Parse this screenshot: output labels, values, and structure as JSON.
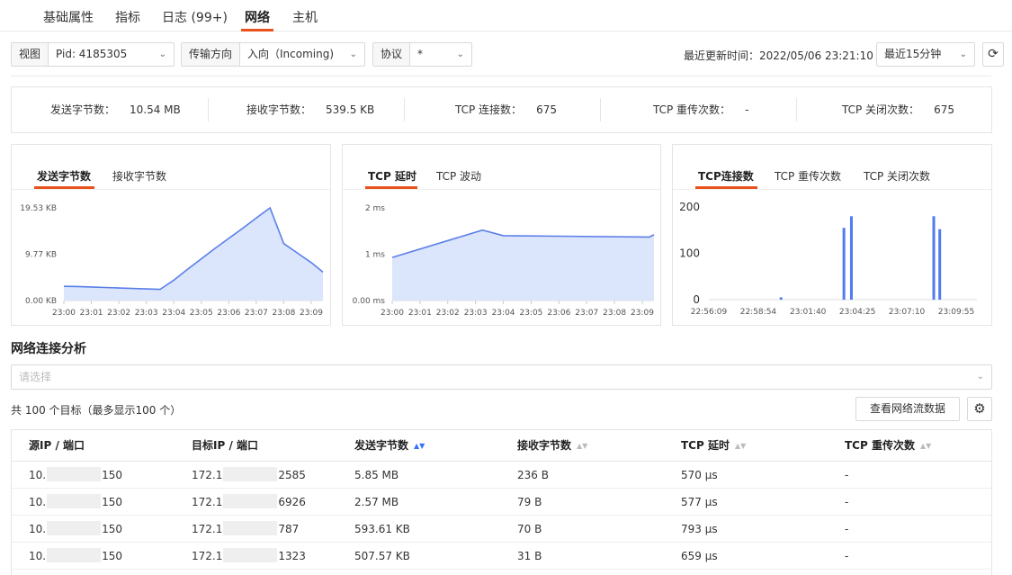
{
  "tabs": [
    {
      "label": "基础属性"
    },
    {
      "label": "指标"
    },
    {
      "label": "日志 (99+)"
    },
    {
      "label": "网络",
      "active": true
    },
    {
      "label": "主机"
    }
  ],
  "filters": {
    "view_label": "视图",
    "view_value": "Pid: 4185305",
    "direction_label": "传输方向",
    "direction_value": "入向（Incoming)",
    "protocol_label": "协议",
    "protocol_value": "*",
    "updated_label": "最近更新时间：2022/05/06 23:21:10",
    "range_value": "最近15分钟"
  },
  "stats": [
    {
      "label": "发送字节数：",
      "value": "10.54 MB"
    },
    {
      "label": "接收字节数：",
      "value": "539.5 KB"
    },
    {
      "label": "TCP 连接数：",
      "value": "675"
    },
    {
      "label": "TCP 重传次数：",
      "value": "-"
    },
    {
      "label": "TCP 关闭次数：",
      "value": "675"
    }
  ],
  "panels": [
    {
      "tabs": [
        "发送字节数",
        "接收字节数"
      ],
      "active": 0
    },
    {
      "tabs": [
        "TCP 延时",
        "TCP 波动"
      ],
      "active": 0
    },
    {
      "tabs": [
        "TCP连接数",
        "TCP 重传次数",
        "TCP 关闭次数"
      ],
      "active": 0
    }
  ],
  "chart_data": [
    {
      "type": "area",
      "title": "发送字节数",
      "yticks": [
        "19.53 KB",
        "9.77 KB",
        "0.00 KB"
      ],
      "ylim": [
        0,
        19.53
      ],
      "x": [
        "23:00",
        "23:00:30",
        "23:01",
        "23:01:30",
        "23:02",
        "23:02:30",
        "23:03",
        "23:03:30",
        "23:04",
        "23:04:30",
        "23:05",
        "23:05:30",
        "23:06",
        "23:06:30",
        "23:07",
        "23:07:30",
        "23:08",
        "23:08:30",
        "23:09",
        "23:09:30"
      ],
      "xticks": [
        "23:00",
        "23:01",
        "23:02",
        "23:03",
        "23:04",
        "23:05",
        "23:06",
        "23:07",
        "23:08",
        "23:09"
      ],
      "values": [
        3.0,
        2.95,
        2.85,
        2.75,
        2.65,
        2.55,
        2.45,
        2.35,
        4.3,
        6.6,
        8.8,
        11.0,
        13.1,
        15.2,
        17.4,
        19.53,
        12.0,
        10.0,
        8.0,
        6.0
      ],
      "series_color": "#5b7fe8"
    },
    {
      "type": "area",
      "title": "TCP 延时",
      "yticks": [
        "2 ms",
        "1 ms",
        "0.00 ms"
      ],
      "ylim": [
        0,
        2
      ],
      "x": [
        "23:00",
        "23:03:15",
        "23:04",
        "23:09:15",
        "23:09:45"
      ],
      "xticks": [
        "23:00",
        "23:01",
        "23:02",
        "23:03",
        "23:04",
        "23:05",
        "23:06",
        "23:07",
        "23:08",
        "23:09"
      ],
      "values": [
        0.93,
        1.52,
        1.4,
        1.37,
        1.42
      ],
      "series_color": "#5b7fe8"
    },
    {
      "type": "bar",
      "title": "TCP连接数",
      "yticks": [
        "200",
        "100",
        "0"
      ],
      "ylim": [
        0,
        200
      ],
      "xticks": [
        "22:56:09",
        "22:58:54",
        "23:01:40",
        "23:04:25",
        "23:07:10",
        "23:09:55"
      ],
      "bars": [
        {
          "t": "23:00:10",
          "value": 5
        },
        {
          "t": "23:03:40",
          "value": 155
        },
        {
          "t": "23:04:05",
          "value": 180
        },
        {
          "t": "23:08:40",
          "value": 180
        },
        {
          "t": "23:09:00",
          "value": 152
        }
      ],
      "series_color": "#4f7cf0"
    }
  ],
  "section": {
    "title": "网络连接分析",
    "select_placeholder": "请选择",
    "count_text": "共 100 个目标（最多显示100 个）",
    "flow_button": "查看网络流数据"
  },
  "table": {
    "columns": [
      "源IP / 端口",
      "目标IP / 端口",
      "发送字节数",
      "接收字节数",
      "TCP 延时",
      "TCP 重传次数"
    ],
    "rows": [
      {
        "src_prefix": "10.",
        "src_suffix": "150",
        "dst_prefix": "172.1",
        "dst_suffix": "2585",
        "sent": "5.85 MB",
        "recv": "236 B",
        "latency": "570 µs",
        "retrans": "-"
      },
      {
        "src_prefix": "10.",
        "src_suffix": "150",
        "dst_prefix": "172.1",
        "dst_suffix": "6926",
        "sent": "2.57 MB",
        "recv": "79 B",
        "latency": "577 µs",
        "retrans": "-"
      },
      {
        "src_prefix": "10.",
        "src_suffix": "150",
        "dst_prefix": "172.1",
        "dst_suffix": "787",
        "sent": "593.61 KB",
        "recv": "70 B",
        "latency": "793 µs",
        "retrans": "-"
      },
      {
        "src_prefix": "10.",
        "src_suffix": "150",
        "dst_prefix": "172.1",
        "dst_suffix": "1323",
        "sent": "507.57 KB",
        "recv": "31 B",
        "latency": "659 µs",
        "retrans": "-"
      }
    ]
  },
  "icons": {
    "chevron": "chevron-down-icon",
    "refresh": "refresh-icon",
    "gear": "gear-icon",
    "sort": "sort-icon"
  }
}
